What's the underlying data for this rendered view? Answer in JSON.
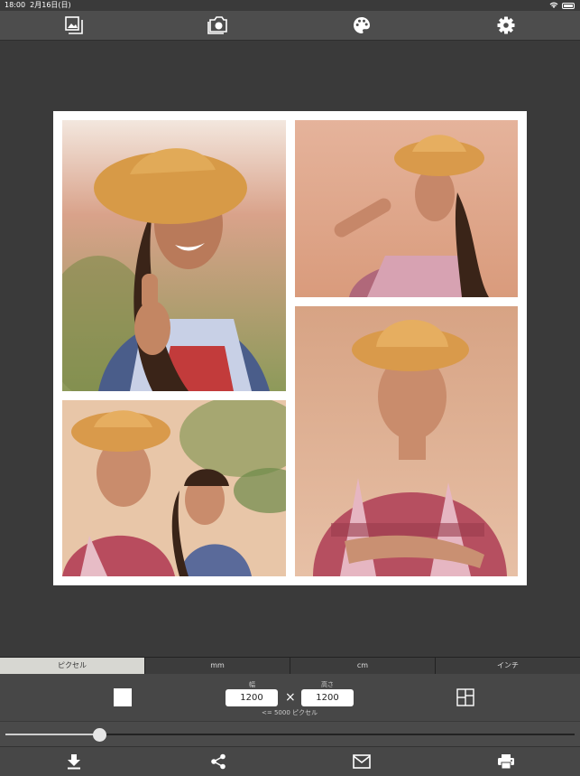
{
  "status": {
    "time": "18:00",
    "date": "2月16日(日)"
  },
  "toolbar": {
    "icons": [
      "photo-library-icon",
      "camera-icon",
      "palette-icon",
      "gear-icon"
    ]
  },
  "units": {
    "tabs": [
      "ピクセル",
      "mm",
      "cm",
      "インチ"
    ],
    "active": "ピクセル"
  },
  "size": {
    "width_label": "幅",
    "height_label": "高さ",
    "width_value": "1200",
    "height_value": "1200",
    "times": "×",
    "limit": "<= 5000 ピクセル"
  },
  "slider": {
    "value": 0.165
  },
  "colors": {
    "accent_bg": "#3a3a3a",
    "toolbar": "#4d4d4d",
    "tab_active": "#d7d7d2"
  },
  "bottombar": {
    "icons": [
      "download-icon",
      "share-icon",
      "mail-icon",
      "print-icon"
    ]
  }
}
